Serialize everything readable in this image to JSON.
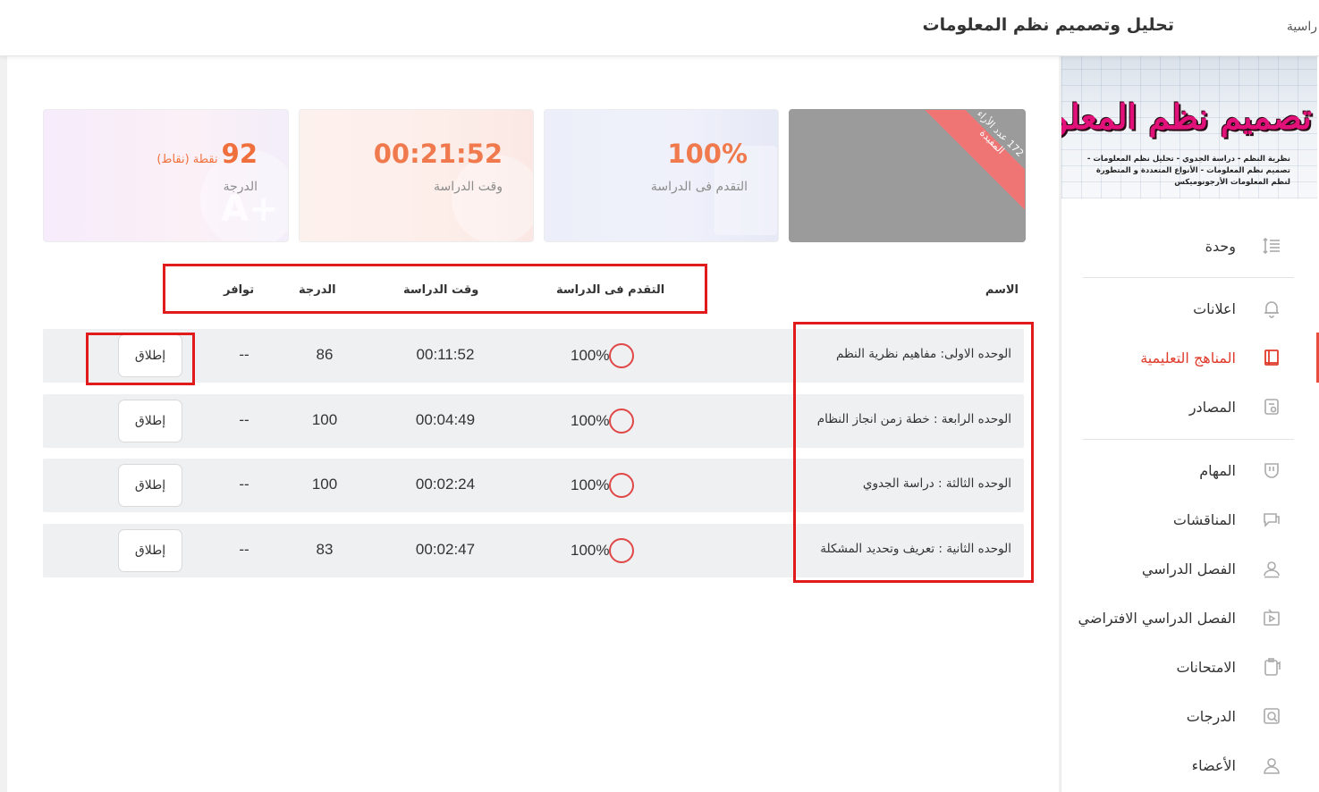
{
  "header": {
    "breadcrumb": "راسية",
    "course_title": "تحليل وتصميم نظم المعلومات"
  },
  "banner": {
    "title": "تصميم نظم المعلومات",
    "subtitle": "نظرية النظم - دراسة الجدوي - تحليل نظم المعلومات - تصميم نظم المعلومات - الأنواع المتعددة و المتطورة لنظم المعلومات الأرجونوميكس"
  },
  "sidebar": {
    "items": [
      {
        "label": "وحدة",
        "icon": "list-icon"
      },
      {
        "label": "اعلانات",
        "icon": "bell-icon"
      },
      {
        "label": "المناهج التعليمية",
        "icon": "book-icon",
        "active": true
      },
      {
        "label": "المصادر",
        "icon": "resources-icon"
      },
      {
        "label": "المهام",
        "icon": "shield-icon"
      },
      {
        "label": "المناقشات",
        "icon": "chat-icon"
      },
      {
        "label": "الفصل الدراسي",
        "icon": "user-icon"
      },
      {
        "label": "الفصل الدراسي الافتراضي",
        "icon": "video-icon"
      },
      {
        "label": "الامتحانات",
        "icon": "clipboard-icon"
      },
      {
        "label": "الدرجات",
        "icon": "grades-icon"
      },
      {
        "label": "الأعضاء",
        "icon": "member-icon"
      }
    ],
    "active_color": "#e03a2b"
  },
  "cards": {
    "grade": {
      "value": "92",
      "unit": "نقطة (نقاط)",
      "label": "الدرجة"
    },
    "time": {
      "value": "00:21:52",
      "label": "وقت الدراسة"
    },
    "progress": {
      "value": "100%",
      "label": "التقدم فى الدراسة"
    },
    "ribbon": {
      "text": "172 عدد الأراء المفيدة"
    }
  },
  "table": {
    "headers": {
      "name": "الاسم",
      "progress": "التقدم فى الدراسة",
      "time": "وقت الدراسة",
      "grade": "الدرجة",
      "availability": "توافر"
    },
    "rows": [
      {
        "name": "الوحده الاولى: مفاهيم نظرية النظم",
        "progress": "100%",
        "time": "00:11:52",
        "grade": "86",
        "availability": "--",
        "action": "إطلاق"
      },
      {
        "name": "الوحده الرابعة : خطة زمن انجاز النظام",
        "progress": "100%",
        "time": "00:04:49",
        "grade": "100",
        "availability": "--",
        "action": "إطلاق"
      },
      {
        "name": "الوحده الثالثة : دراسة الجدوي",
        "progress": "100%",
        "time": "00:02:24",
        "grade": "100",
        "availability": "--",
        "action": "إطلاق"
      },
      {
        "name": "الوحده الثانية : تعريف وتحديد المشكلة",
        "progress": "100%",
        "time": "00:02:47",
        "grade": "83",
        "availability": "--",
        "action": "إطلاق"
      }
    ]
  },
  "colors": {
    "accent": "#e03a2b",
    "highlight_box": "#e11b1b",
    "progress_ring": "#e04848"
  }
}
